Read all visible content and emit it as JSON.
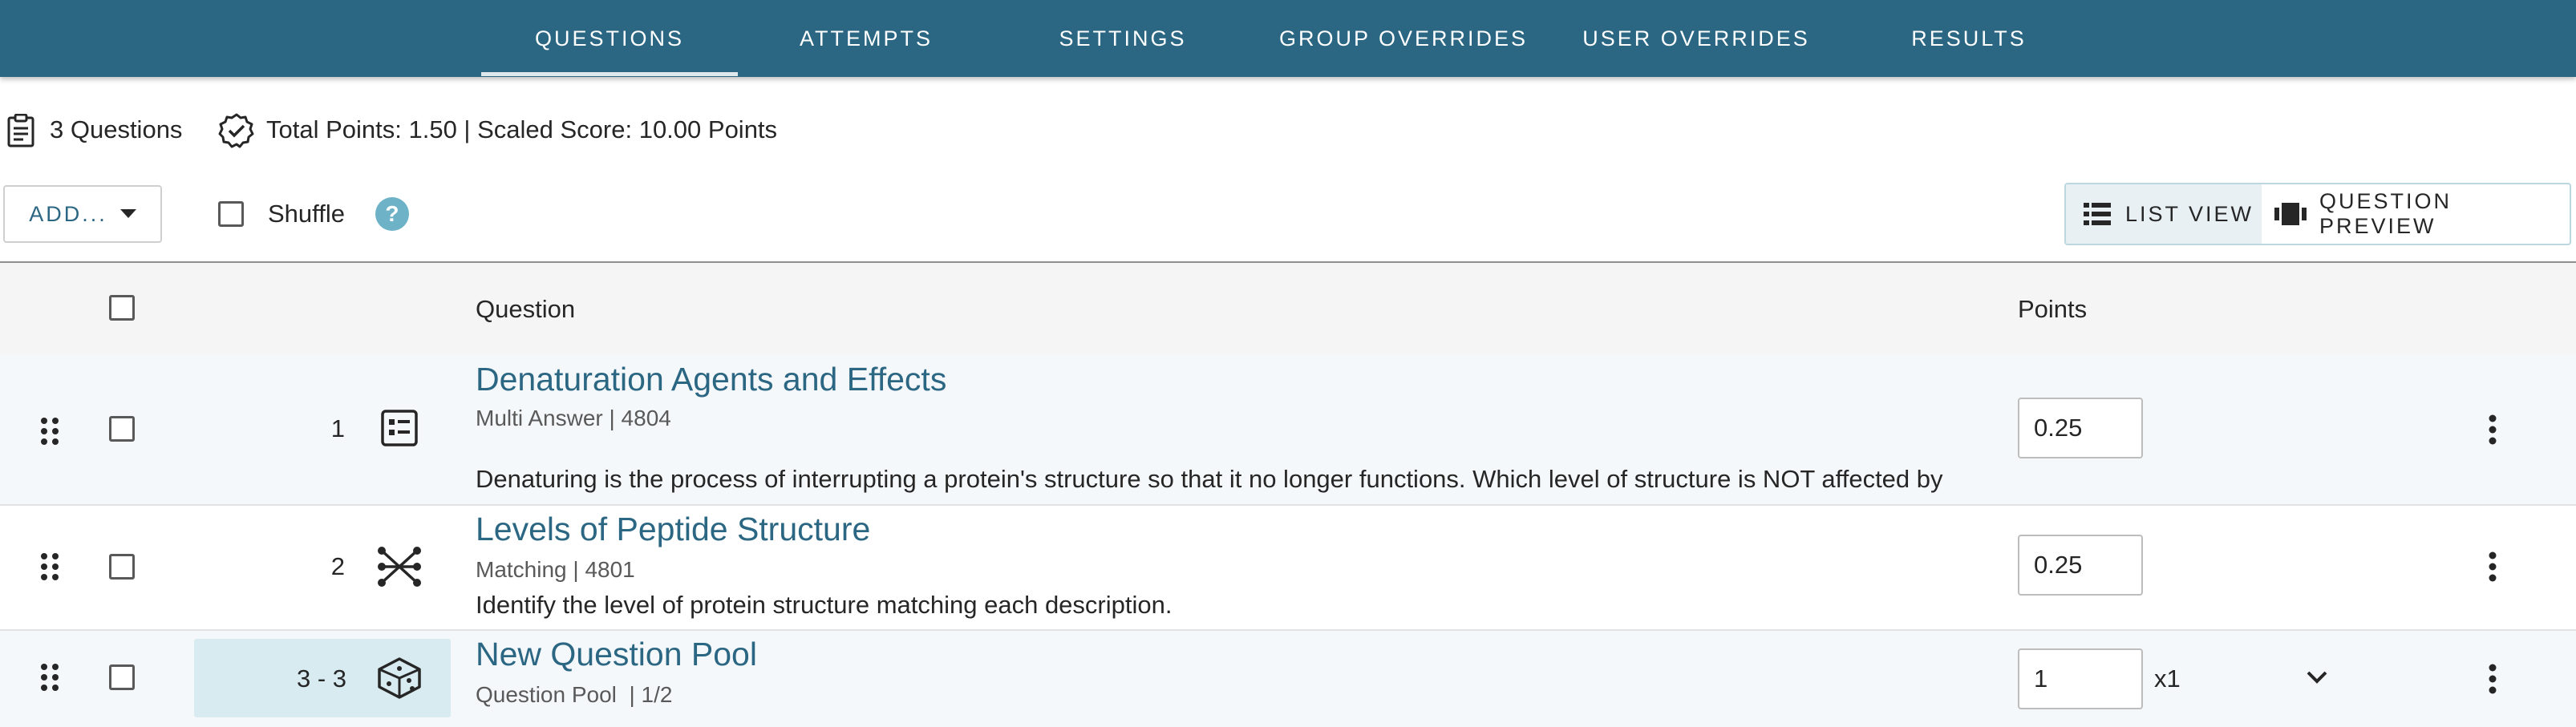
{
  "tabs": [
    {
      "label": "QUESTIONS",
      "active": true
    },
    {
      "label": "ATTEMPTS"
    },
    {
      "label": "SETTINGS"
    },
    {
      "label": "GROUP OVERRIDES"
    },
    {
      "label": "USER OVERRIDES"
    },
    {
      "label": "RESULTS"
    }
  ],
  "summary": {
    "question_count": "3 Questions",
    "points_text": "Total Points: 1.50 | Scaled Score: 10.00 Points"
  },
  "toolbar": {
    "add_label": "ADD...",
    "shuffle_label": "Shuffle",
    "help_glyph": "?",
    "list_view_label": "LIST VIEW",
    "question_preview_label": "QUESTION PREVIEW"
  },
  "table": {
    "col_question": "Question",
    "col_points": "Points"
  },
  "questions": [
    {
      "number": "1",
      "title": "Denaturation Agents and Effects",
      "meta": "Multi Answer | 4804",
      "text": "Denaturing is the process of interrupting a protein's structure so that it no longer functions. Which level of structure is NOT affected by",
      "points": "0.25",
      "icon": "multi-answer-icon"
    },
    {
      "number": "2",
      "title": "Levels of Peptide Structure",
      "meta": "Matching | 4801",
      "text": "Identify the level of protein structure matching each description.",
      "points": "0.25",
      "icon": "matching-icon"
    },
    {
      "number": "3 - 3",
      "title": "New Question Pool",
      "meta": "Question Pool  | 1/2",
      "points": "1",
      "multiplier": "x1",
      "icon": "dice-icon"
    }
  ],
  "colors": {
    "header_bg": "#2b6683",
    "link": "#2b6683",
    "help": "#6eb2c8",
    "pool_number_bg": "#d8ebf0"
  }
}
